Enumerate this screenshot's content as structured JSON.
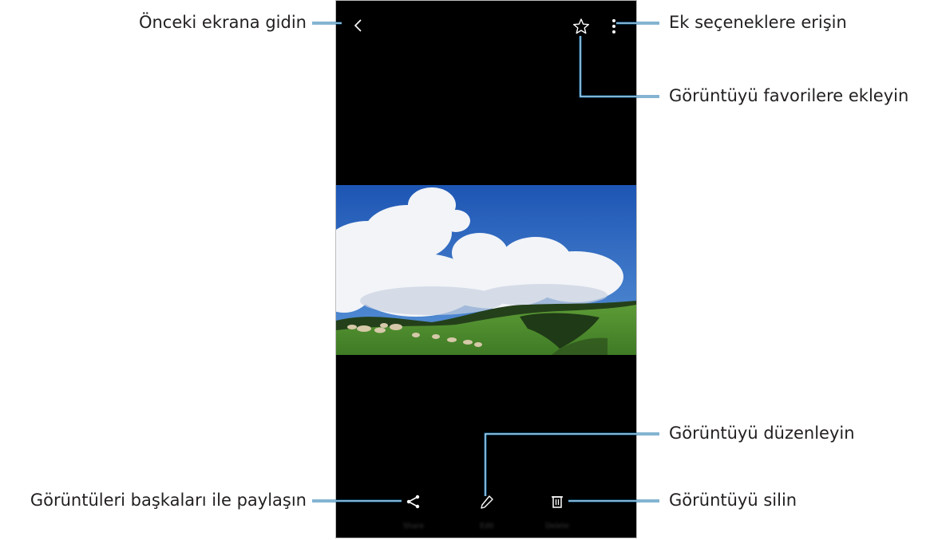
{
  "callouts": {
    "back": "Önceki ekrana gidin",
    "more_options": "Ek seçeneklere erişin",
    "favorite": "Görüntüyü favorilere ekleyin",
    "edit": "Görüntüyü düzenleyin",
    "share": "Görüntüleri başkaları ile paylaşın",
    "delete": "Görüntüyü silin"
  },
  "toolbar": {
    "share_label": "Share",
    "edit_label": "Edit",
    "delete_label": "Delete"
  },
  "icons": {
    "back": "chevron-left-icon",
    "favorite": "star-outline-icon",
    "more": "vertical-dots-icon",
    "share": "share-icon",
    "edit": "pencil-icon",
    "delete": "trash-icon"
  },
  "colors": {
    "screen_background": "#000000",
    "leader_line": "#0a6aa6",
    "icon": "#ffffff",
    "callout_text": "#231f20"
  }
}
